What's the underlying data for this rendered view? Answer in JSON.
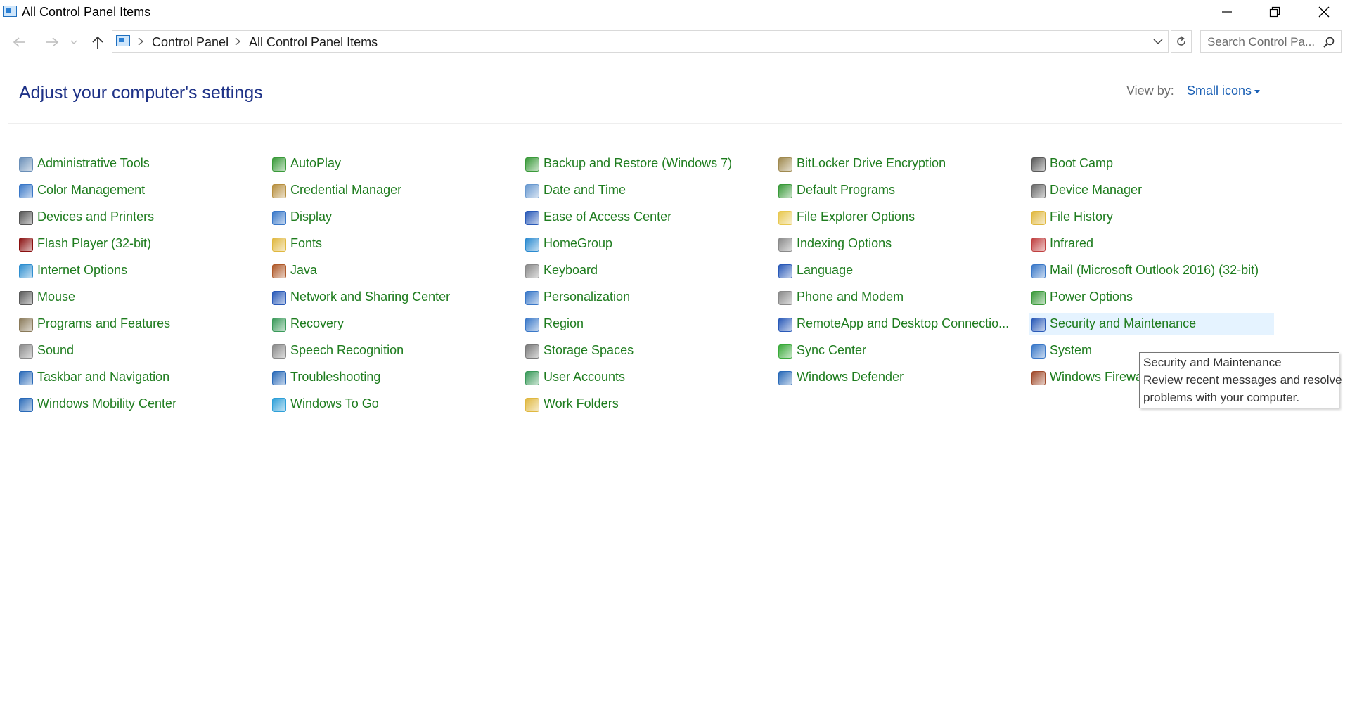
{
  "window": {
    "title": "All Control Panel Items",
    "icon": "control-panel-icon"
  },
  "navbar": {
    "breadcrumb": [
      "Control Panel",
      "All Control Panel Items"
    ],
    "search_placeholder": "Search Control Pa..."
  },
  "header": {
    "title": "Adjust your computer's settings",
    "view_by_label": "View by:",
    "view_by_value": "Small icons"
  },
  "columns": [
    {
      "items": [
        {
          "label": "Administrative Tools",
          "icon": "administrative-tools-icon",
          "color": "#6a8fb8"
        },
        {
          "label": "Color Management",
          "icon": "color-management-icon",
          "color": "#3a78c8"
        },
        {
          "label": "Devices and Printers",
          "icon": "devices-printers-icon",
          "color": "#555555"
        },
        {
          "label": "Flash Player (32-bit)",
          "icon": "flash-player-icon",
          "color": "#8a1010"
        },
        {
          "label": "Internet Options",
          "icon": "internet-options-icon",
          "color": "#2f8fd0"
        },
        {
          "label": "Mouse",
          "icon": "mouse-icon",
          "color": "#5a5a5a"
        },
        {
          "label": "Programs and Features",
          "icon": "programs-features-icon",
          "color": "#8a7a5a"
        },
        {
          "label": "Sound",
          "icon": "sound-icon",
          "color": "#8a8a8a"
        },
        {
          "label": "Taskbar and Navigation",
          "icon": "taskbar-icon",
          "color": "#2a6ab8"
        },
        {
          "label": "Windows Mobility Center",
          "icon": "mobility-center-icon",
          "color": "#2a6ab8"
        }
      ]
    },
    {
      "items": [
        {
          "label": "AutoPlay",
          "icon": "autoplay-icon",
          "color": "#3a9a3a"
        },
        {
          "label": "Credential Manager",
          "icon": "credential-manager-icon",
          "color": "#b89040"
        },
        {
          "label": "Display",
          "icon": "display-icon",
          "color": "#3a78c8"
        },
        {
          "label": "Fonts",
          "icon": "fonts-icon",
          "color": "#e0b840"
        },
        {
          "label": "Java",
          "icon": "java-icon",
          "color": "#b05a2a"
        },
        {
          "label": "Network and Sharing Center",
          "icon": "network-icon",
          "color": "#2a5ab8"
        },
        {
          "label": "Recovery",
          "icon": "recovery-icon",
          "color": "#3a9a5a"
        },
        {
          "label": "Speech Recognition",
          "icon": "microphone-icon",
          "color": "#8a8a8a"
        },
        {
          "label": "Troubleshooting",
          "icon": "troubleshooting-icon",
          "color": "#2a6ab8"
        },
        {
          "label": "Windows To Go",
          "icon": "windows-to-go-icon",
          "color": "#2fa0d8"
        }
      ]
    },
    {
      "items": [
        {
          "label": "Backup and Restore (Windows 7)",
          "icon": "backup-restore-icon",
          "color": "#3a9a3a"
        },
        {
          "label": "Date and Time",
          "icon": "date-time-icon",
          "color": "#6a9ad0"
        },
        {
          "label": "Ease of Access Center",
          "icon": "ease-of-access-icon",
          "color": "#2a5ab8"
        },
        {
          "label": "HomeGroup",
          "icon": "homegroup-icon",
          "color": "#2a8ad0"
        },
        {
          "label": "Keyboard",
          "icon": "keyboard-icon",
          "color": "#8a8a8a"
        },
        {
          "label": "Personalization",
          "icon": "personalization-icon",
          "color": "#3a78c8"
        },
        {
          "label": "Region",
          "icon": "region-icon",
          "color": "#3a78c8"
        },
        {
          "label": "Storage Spaces",
          "icon": "storage-spaces-icon",
          "color": "#7a7a7a"
        },
        {
          "label": "User Accounts",
          "icon": "user-accounts-icon",
          "color": "#3a9a5a"
        },
        {
          "label": "Work Folders",
          "icon": "work-folders-icon",
          "color": "#e0b840"
        }
      ]
    },
    {
      "items": [
        {
          "label": "BitLocker Drive Encryption",
          "icon": "bitlocker-icon",
          "color": "#a08a50"
        },
        {
          "label": "Default Programs",
          "icon": "default-programs-icon",
          "color": "#3a9a3a"
        },
        {
          "label": "File Explorer Options",
          "icon": "folder-options-icon",
          "color": "#e8c850"
        },
        {
          "label": "Indexing Options",
          "icon": "indexing-options-icon",
          "color": "#8a8a8a"
        },
        {
          "label": "Language",
          "icon": "language-icon",
          "color": "#2a5ab8"
        },
        {
          "label": "Phone and Modem",
          "icon": "phone-modem-icon",
          "color": "#8a8a8a"
        },
        {
          "label": "RemoteApp and Desktop Connectio...",
          "icon": "remoteapp-icon",
          "color": "#2a5ab8"
        },
        {
          "label": "Sync Center",
          "icon": "sync-center-icon",
          "color": "#3aaa3a"
        },
        {
          "label": "Windows Defender",
          "icon": "windows-defender-icon",
          "color": "#2a6ab8"
        }
      ]
    },
    {
      "items": [
        {
          "label": "Boot Camp",
          "icon": "boot-camp-icon",
          "color": "#5a5a5a"
        },
        {
          "label": "Device Manager",
          "icon": "device-manager-icon",
          "color": "#6a6a6a"
        },
        {
          "label": "File History",
          "icon": "file-history-icon",
          "color": "#e0b840"
        },
        {
          "label": "Infrared",
          "icon": "infrared-icon",
          "color": "#c04040"
        },
        {
          "label": "Mail (Microsoft Outlook 2016) (32-bit)",
          "icon": "mail-icon",
          "color": "#3a78c8"
        },
        {
          "label": "Power Options",
          "icon": "power-options-icon",
          "color": "#3a9a3a"
        },
        {
          "label": "Security and Maintenance",
          "icon": "security-maintenance-icon",
          "color": "#2a5ab8",
          "hovered": true
        },
        {
          "label": "System",
          "icon": "system-icon",
          "color": "#3a78c8"
        },
        {
          "label": "Windows Firewall",
          "icon": "windows-firewall-icon",
          "color": "#a04a2a"
        }
      ]
    }
  ],
  "tooltip": {
    "title": "Security and Maintenance",
    "lines": [
      "Review recent messages and resolve",
      "problems with your computer."
    ]
  },
  "colors": {
    "link": "#1e7c1e",
    "heading": "#1e3287",
    "accent": "#1a5fb4",
    "hover": "#e5f3ff"
  }
}
